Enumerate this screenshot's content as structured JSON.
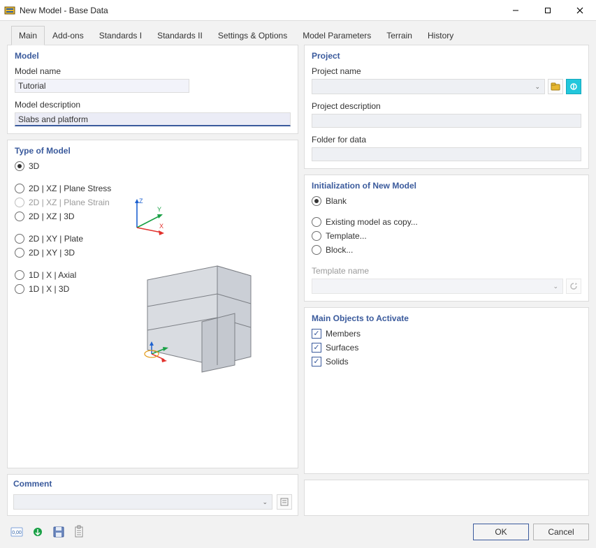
{
  "window": {
    "title": "New Model - Base Data"
  },
  "tabs": [
    "Main",
    "Add-ons",
    "Standards I",
    "Standards II",
    "Settings & Options",
    "Model Parameters",
    "Terrain",
    "History"
  ],
  "active_tab": 0,
  "model_panel": {
    "title": "Model",
    "name_label": "Model name",
    "name_value": "Tutorial",
    "desc_label": "Model description",
    "desc_value": "Slabs and platform"
  },
  "type_panel": {
    "title": "Type of Model",
    "options": [
      {
        "label": "3D",
        "selected": true,
        "disabled": false
      },
      {
        "label": "2D | XZ | Plane Stress",
        "selected": false,
        "disabled": false
      },
      {
        "label": "2D | XZ | Plane Strain",
        "selected": false,
        "disabled": true
      },
      {
        "label": "2D | XZ | 3D",
        "selected": false,
        "disabled": false
      },
      {
        "label": "2D | XY | Plate",
        "selected": false,
        "disabled": false
      },
      {
        "label": "2D | XY | 3D",
        "selected": false,
        "disabled": false
      },
      {
        "label": "1D | X | Axial",
        "selected": false,
        "disabled": false
      },
      {
        "label": "1D | X | 3D",
        "selected": false,
        "disabled": false
      }
    ]
  },
  "project_panel": {
    "title": "Project",
    "name_label": "Project name",
    "name_value": "",
    "desc_label": "Project description",
    "desc_value": "",
    "folder_label": "Folder for data",
    "folder_value": ""
  },
  "init_panel": {
    "title": "Initialization of New Model",
    "options": [
      {
        "label": "Blank",
        "selected": true
      },
      {
        "label": "Existing model as copy...",
        "selected": false
      },
      {
        "label": "Template...",
        "selected": false
      },
      {
        "label": "Block...",
        "selected": false
      }
    ],
    "template_label": "Template name",
    "template_value": ""
  },
  "main_objects_panel": {
    "title": "Main Objects to Activate",
    "items": [
      {
        "label": "Members",
        "checked": true
      },
      {
        "label": "Surfaces",
        "checked": true
      },
      {
        "label": "Solids",
        "checked": true
      }
    ]
  },
  "comment_panel": {
    "title": "Comment",
    "value": ""
  },
  "footer": {
    "ok": "OK",
    "cancel": "Cancel"
  }
}
